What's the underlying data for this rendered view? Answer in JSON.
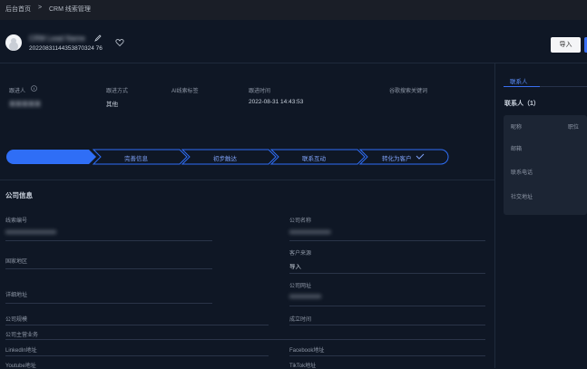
{
  "breadcrumb": {
    "home": "后台首页",
    "sep": ">",
    "current": "CRM 线索管理"
  },
  "header": {
    "name_blurred": "CRM Lead Name",
    "lead_id": "20220831144353870324 76"
  },
  "buttons": {
    "import": "导入"
  },
  "info": {
    "follower_label": "跟进人",
    "follower_value": "某某某某某",
    "follow_method_label": "跟进方式",
    "follow_method_value": "其他",
    "ai_tags_label": "AI线索标签",
    "follow_time_label": "跟进时间",
    "follow_time_value": "2022-08-31 14:43:53",
    "search_kw_label": "谷歌搜索关键词"
  },
  "steps": [
    "",
    "完善信息",
    "初步触达",
    "联系互动",
    "转化为客户"
  ],
  "company": {
    "section_title": "公司信息",
    "lead_no_label": "线索编号",
    "lead_no_value": "xxxxxxxxxxxxxxxx",
    "company_name_label": "公司名称",
    "company_name_value": "xxxxxxxxxxxxx",
    "country_label": "国家地区",
    "source_label": "客户来源",
    "source_value": "导入",
    "address_label": "详细地址",
    "website_label": "公司网址",
    "website_value": "xxxxxxxxxx",
    "scale_label": "公司规模",
    "established_label": "成立时间",
    "main_business_label": "公司主营业务",
    "linkedin_label": "LinkedIn地址",
    "facebook_label": "Facebook地址",
    "youtube_label": "Youtube地址",
    "tiktok_label": "TikTok地址"
  },
  "contacts": {
    "tab": "联系人",
    "count_title": "联系人（1）",
    "nickname_label": "昵称",
    "position_label": "职位",
    "email_label": "邮箱",
    "phone_label": "联系电话",
    "social_label": "社交地址"
  },
  "lead_id_display": "20220831144353870324 76"
}
